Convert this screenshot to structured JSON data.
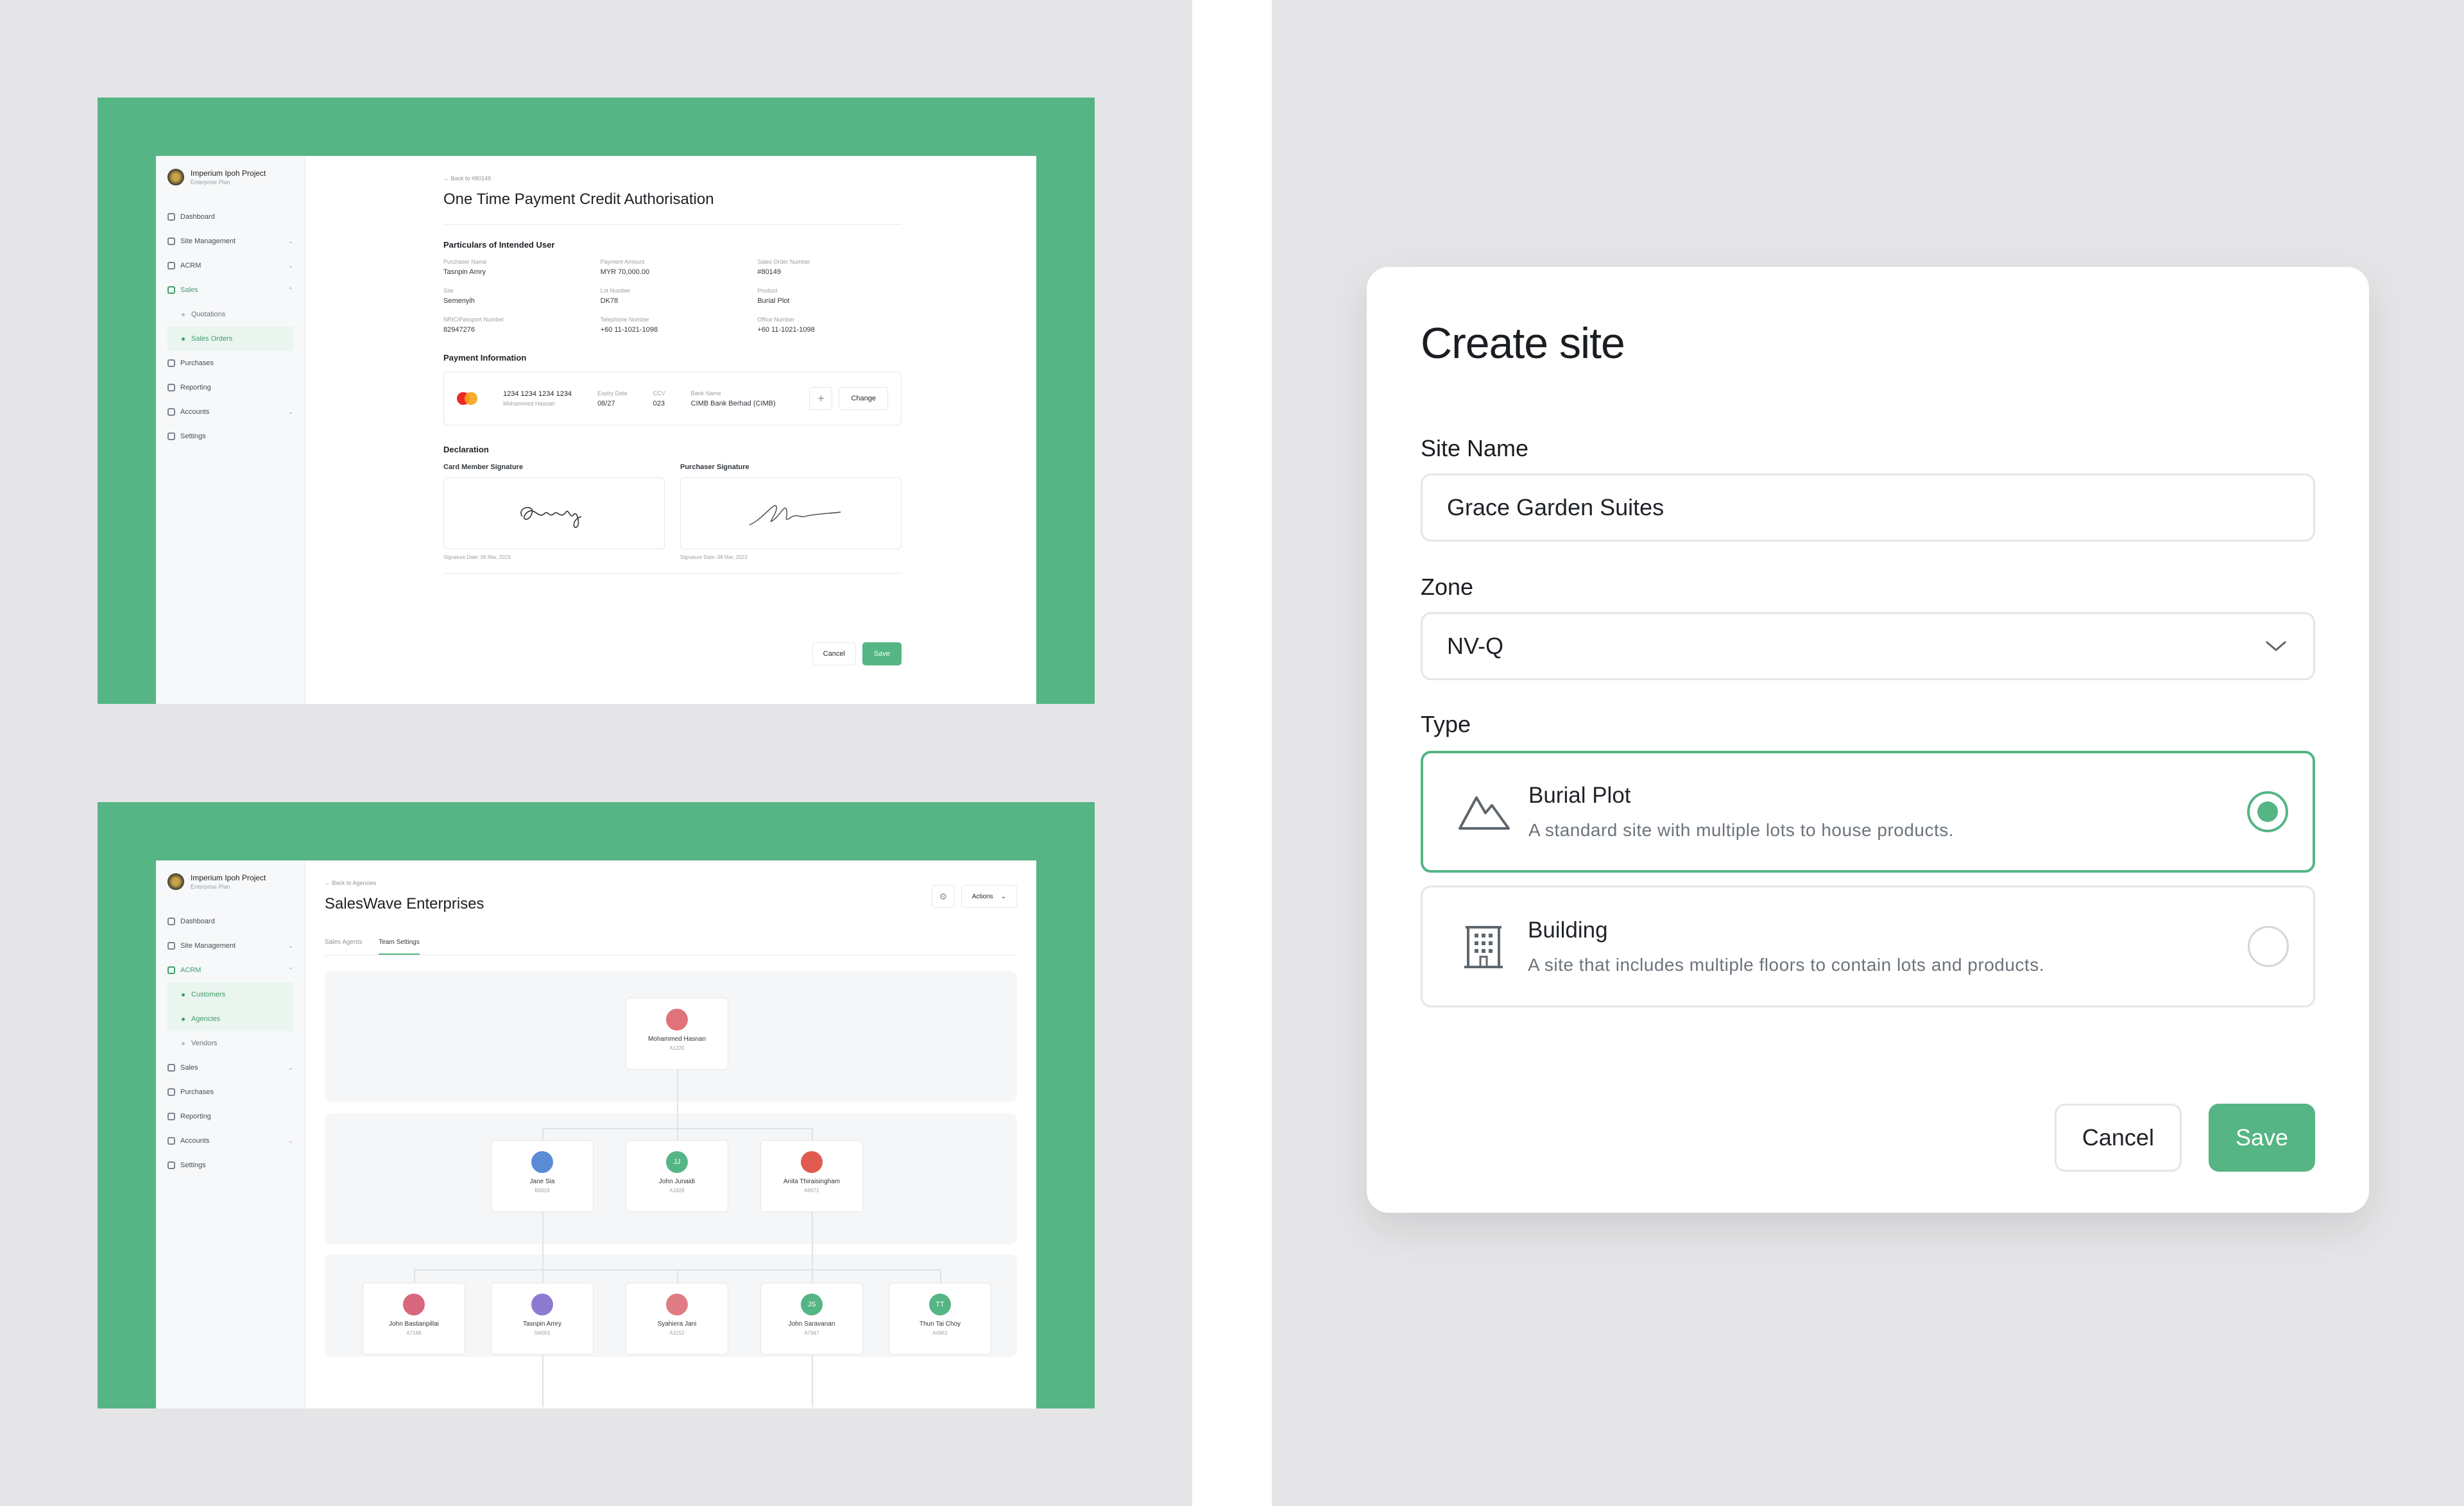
{
  "payment_screen": {
    "org_name": "Imperium Ipoh Project",
    "org_plan": "Enterprise Plan",
    "nav": [
      {
        "label": "Dashboard"
      },
      {
        "label": "Site Management"
      },
      {
        "label": "ACRM"
      },
      {
        "label": "Sales"
      },
      {
        "label": "Quotations"
      },
      {
        "label": "Sales Orders"
      },
      {
        "label": "Purchases"
      },
      {
        "label": "Reporting"
      },
      {
        "label": "Accounts"
      },
      {
        "label": "Settings"
      }
    ],
    "back_link": "Back to #80149",
    "title": "One Time Payment Credit Authorisation",
    "section_particulars": "Particulars of Intended User",
    "fields": [
      {
        "label": "Purchaser Name",
        "value": "Tasnpin Amry"
      },
      {
        "label": "Payment Amount",
        "value": "MYR 70,000.00"
      },
      {
        "label": "Sales Order Number",
        "value": "#80149"
      },
      {
        "label": "Site",
        "value": "Semenyih"
      },
      {
        "label": "Lot Number",
        "value": "DK78"
      },
      {
        "label": "Product",
        "value": "Burial Plot"
      },
      {
        "label": "NRIC/Passport Number",
        "value": "82947276"
      },
      {
        "label": "Telephone Number",
        "value": "+60 11-1021-1098"
      },
      {
        "label": "Office Number",
        "value": "+60 11-1021-1098"
      }
    ],
    "section_payment": "Payment Information",
    "card_number": "1234 1234 1234 1234",
    "card_holder": "Mohammed Hasnan",
    "expiry_label": "Expiry Date",
    "expiry_value": "08/27",
    "ccv_label": "CCV",
    "ccv_value": "023",
    "bank_label": "Bank Name",
    "bank_value": "CIMB Bank Berhad (CIMB)",
    "change_label": "Change",
    "section_declaration": "Declaration",
    "card_member_sig": "Card Member Signature",
    "purchaser_sig": "Purchaser Signature",
    "sig_date_1": "Signature Date: 08 Mar, 2023",
    "sig_date_2": "Signature Date: 08 Mar, 2023",
    "cancel": "Cancel",
    "save": "Save"
  },
  "team_screen": {
    "org_name": "Imperium Ipoh Project",
    "org_plan": "Enterprise Plan",
    "nav": [
      {
        "label": "Dashboard"
      },
      {
        "label": "Site Management"
      },
      {
        "label": "ACRM"
      },
      {
        "label": "Customers"
      },
      {
        "label": "Agencies"
      },
      {
        "label": "Vendors"
      },
      {
        "label": "Sales"
      },
      {
        "label": "Purchases"
      },
      {
        "label": "Reporting"
      },
      {
        "label": "Accounts"
      },
      {
        "label": "Settings"
      }
    ],
    "back_link": "Back to Agencies",
    "title": "SalesWave Enterprises",
    "actions": "Actions",
    "tabs": [
      "Sales Agents",
      "Team Settings"
    ],
    "nodes": [
      {
        "initials": "",
        "name": "Mohammed Hasnan",
        "code": "A1220",
        "color": "#e0727a"
      },
      {
        "initials": "",
        "name": "Jane Sia",
        "code": "B0019",
        "color": "#5b8bd6"
      },
      {
        "initials": "JJ",
        "name": "John Junaidi",
        "code": "A1828",
        "color": "#55b584"
      },
      {
        "initials": "",
        "name": "Anita Thiraisingham",
        "code": "A8671",
        "color": "#e05a4f"
      },
      {
        "initials": "",
        "name": "John Bastianpillai",
        "code": "A7188",
        "color": "#d9677e"
      },
      {
        "initials": "",
        "name": "Tasnpin Amry",
        "code": "SM001",
        "color": "#8d7ad1"
      },
      {
        "initials": "",
        "name": "Syahiera Jani",
        "code": "A3152",
        "color": "#e07b86"
      },
      {
        "initials": "JS",
        "name": "John Saravanan",
        "code": "A7947",
        "color": "#55b584"
      },
      {
        "initials": "TT",
        "name": "Thun Tai Choy",
        "code": "A4961",
        "color": "#55b584"
      }
    ]
  },
  "modal": {
    "title": "Create site",
    "site_name_label": "Site Name",
    "site_name_value": "Grace Garden Suites",
    "zone_label": "Zone",
    "zone_value": "NV-Q",
    "type_label": "Type",
    "options": [
      {
        "title": "Burial Plot",
        "desc": "A standard site with multiple lots to house products."
      },
      {
        "title": "Building",
        "desc": "A site that includes multiple floors to contain lots and products."
      }
    ],
    "cancel": "Cancel",
    "save": "Save",
    "accent": "#55b584"
  }
}
